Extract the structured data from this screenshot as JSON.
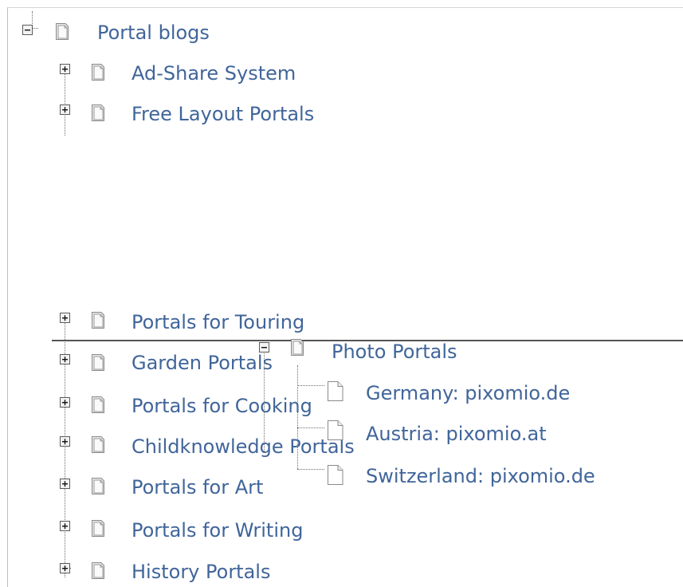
{
  "tree": {
    "root": {
      "label": "Portal blogs",
      "state": "expanded"
    },
    "children": [
      {
        "label": "Ad-Share System",
        "state": "collapsed"
      },
      {
        "label": "Free Layout Portals",
        "state": "collapsed"
      },
      {
        "label": "Portals for Touring",
        "state": "collapsed"
      },
      {
        "label": "Garden Portals",
        "state": "collapsed"
      },
      {
        "label": "Portals for Cooking",
        "state": "collapsed"
      },
      {
        "label": "Childknowledge Portals",
        "state": "collapsed"
      },
      {
        "label": "Portals for Art",
        "state": "collapsed"
      },
      {
        "label": "Portals for Writing",
        "state": "collapsed"
      },
      {
        "label": "History Portals",
        "state": "collapsed"
      }
    ]
  },
  "drag": {
    "folder": {
      "label": "Photo Portals",
      "state": "expanded"
    },
    "leaves": [
      {
        "label": "Germany: pixomio.de"
      },
      {
        "label": "Austria: pixomio.at"
      },
      {
        "label": "Switzerland: pixomio.de"
      }
    ]
  },
  "colors": {
    "link": "#40659a",
    "drop_indicator": "#555555"
  },
  "icons": {
    "expander_open": "minus-box-icon",
    "expander_closed": "plus-box-icon",
    "folder": "folder-icon",
    "leaf": "page-icon"
  }
}
